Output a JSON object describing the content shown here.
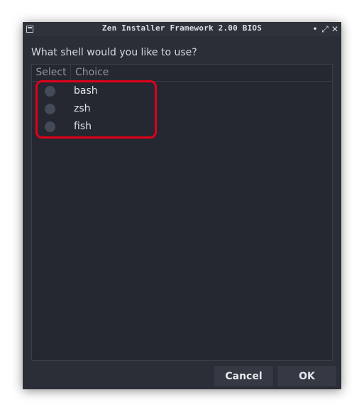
{
  "window": {
    "title": "Zen Installer Framework 2.00 BIOS",
    "controls": {
      "minimize": "•",
      "maximize": "⤢",
      "close": "✕"
    }
  },
  "dialog": {
    "prompt": "What shell would you like to use?",
    "columns": {
      "select": "Select",
      "choice": "Choice"
    },
    "options": [
      {
        "label": "bash",
        "selected": false
      },
      {
        "label": "zsh",
        "selected": false
      },
      {
        "label": "fish",
        "selected": false
      }
    ]
  },
  "buttons": {
    "cancel": "Cancel",
    "ok": "OK"
  },
  "colors": {
    "window_bg": "#2b2e37",
    "list_bg": "#252831",
    "annotation": "#e0001a"
  }
}
